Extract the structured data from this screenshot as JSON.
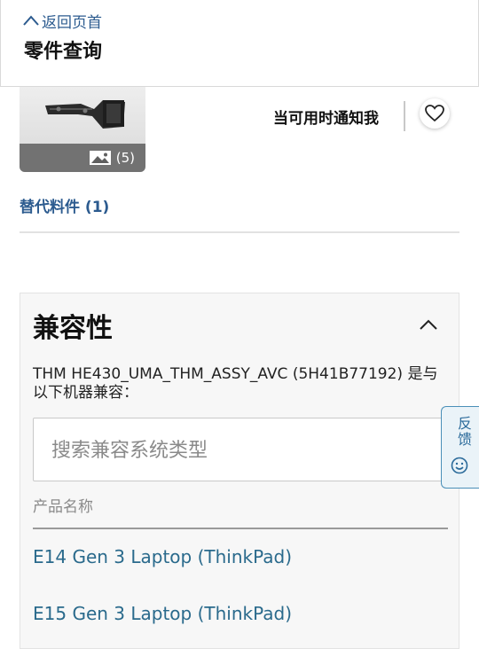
{
  "header": {
    "back_label": "返回页首",
    "title": "零件查询"
  },
  "product": {
    "image_count": "(5)",
    "notify_label": "当可用时通知我",
    "alternates_link": "替代料件 (1)"
  },
  "compatibility": {
    "title": "兼容性",
    "description": "THM HE430_UMA_THM_ASSY_AVC (5H41B77192) 是与以下机器兼容：",
    "search_placeholder": "搜索兼容系统类型",
    "column_header": "产品名称",
    "products": [
      "E14 Gen 3 Laptop (ThinkPad)",
      "E15 Gen 3 Laptop (ThinkPad)"
    ]
  },
  "feedback": {
    "label": "反馈"
  },
  "colors": {
    "link": "#2c5b8f",
    "product_link": "#2a6a8c",
    "feedback_accent": "#4a8fb8"
  }
}
